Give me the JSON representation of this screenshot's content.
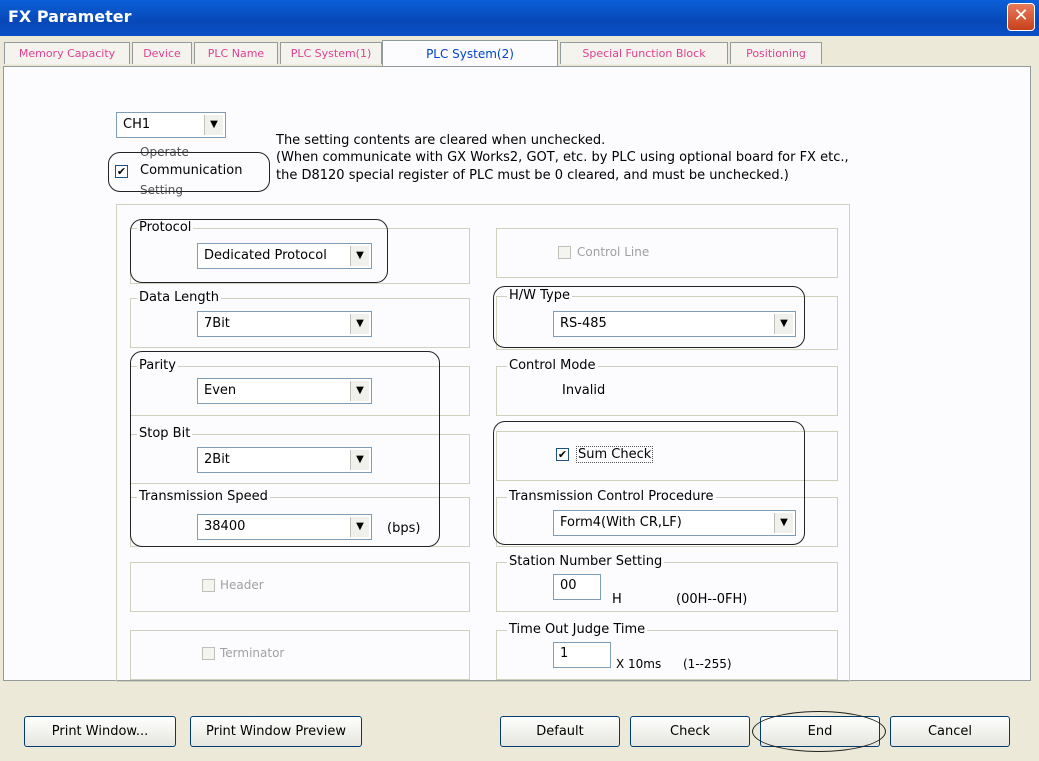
{
  "window": {
    "title": "FX Parameter",
    "close_label": "✕"
  },
  "tabs": [
    "Memory Capacity",
    "Device",
    "PLC Name",
    "PLC System(1)",
    "PLC System(2)",
    "Special Function Block",
    "Positioning"
  ],
  "channel": {
    "value": "CH1"
  },
  "operate": {
    "checked": "✔",
    "label_top": "Operate",
    "label_mid": "Communication",
    "label_bot": "Setting",
    "note1": "The setting contents are cleared when unchecked.",
    "note2": "(When communicate with GX Works2, GOT, etc. by PLC using optional board for FX etc.,",
    "note3": "the D8120 special register of PLC must be 0 cleared, and must be unchecked.)"
  },
  "protocol": {
    "label": "Protocol",
    "value": "Dedicated Protocol"
  },
  "data_length": {
    "label": "Data Length",
    "value": "7Bit"
  },
  "parity": {
    "label": "Parity",
    "value": "Even"
  },
  "stop_bit": {
    "label": "Stop Bit",
    "value": "2Bit"
  },
  "speed": {
    "label": "Transmission Speed",
    "value": "38400",
    "unit": "(bps)"
  },
  "header": {
    "label": "Header"
  },
  "terminator": {
    "label": "Terminator"
  },
  "control_line": {
    "label": "Control Line"
  },
  "hw_type": {
    "label": "H/W Type",
    "value": "RS-485"
  },
  "control_mode": {
    "label": "Control Mode",
    "value": "Invalid"
  },
  "sum_check": {
    "label": "Sum Check",
    "checked": "✔"
  },
  "procedure": {
    "label": "Transmission Control Procedure",
    "value": "Form4(With CR,LF)"
  },
  "station": {
    "label": "Station Number Setting",
    "value": "00",
    "unit": "H",
    "range": "(00H--0FH)"
  },
  "timeout": {
    "label": "Time Out Judge Time",
    "value": "1",
    "unit": "X 10ms",
    "range": "(1--255)"
  },
  "buttons": {
    "print_window": "Print Window...",
    "print_preview": "Print Window Preview",
    "default": "Default",
    "check": "Check",
    "end": "End",
    "cancel": "Cancel"
  }
}
